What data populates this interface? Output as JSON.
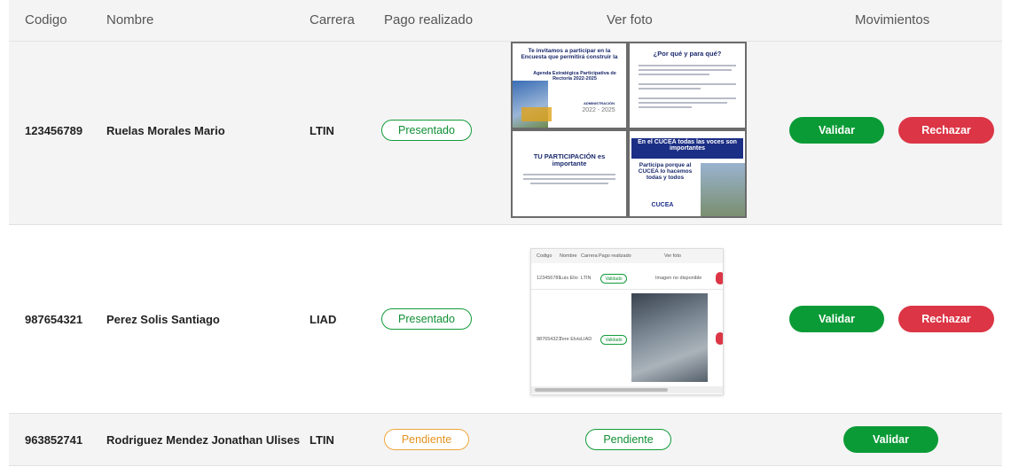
{
  "header": {
    "codigo": "Codigo",
    "nombre": "Nombre",
    "carrera": "Carrera",
    "pago": "Pago realizado",
    "foto": "Ver foto",
    "movimientos": "Movimientos"
  },
  "rows": [
    {
      "codigo": "123456789",
      "nombre": "Ruelas Morales Mario",
      "carrera": "LTIN",
      "pago": "Presentado",
      "validar": "Validar",
      "rechazar": "Rechazar",
      "poster": {
        "p1_title": "Te invitamos a participar en la Encuesta que permitirá construir la",
        "p1_sub": "Agenda Estratégica Participativa de Rectoría 2022-2025",
        "p1_admin": "ADMINISTRACIÓN",
        "p1_years": "2022 - 2025",
        "p2_title": "¿Por qué y para qué?",
        "p3_title": "TU PARTICIPACIÓN es importante",
        "p4_band": "En el CUCEA todas las voces son importantes",
        "p4_body": "Participa porque al CUCEA lo hacemos todas y todos",
        "p4_logo": "CUCEA"
      }
    },
    {
      "codigo": "987654321",
      "nombre": "Perez Solis Santiago",
      "carrera": "LIAD",
      "pago": "Presentado",
      "validar": "Validar",
      "rechazar": "Rechazar",
      "mini": {
        "h_codigo": "Codigo",
        "h_nombre": "Nombre",
        "h_carrera": "Carrera",
        "h_pago": "Pago realizado",
        "h_foto": "Ver foto",
        "r1_codigo": "123456789",
        "r1_nombre": "Luis Elio",
        "r1_carrera": "LTIN",
        "r1_pago": "Validado",
        "r1_foto": "Imagen no disponible",
        "r2_codigo": "987654321",
        "r2_nombre": "Tere Elvis",
        "r2_carrera": "LIAD",
        "r2_pago": "Validado"
      }
    },
    {
      "codigo": "963852741",
      "nombre": "Rodriguez Mendez Jonathan Ulises",
      "carrera": "LTIN",
      "pago": "Pendiente",
      "foto_status": "Pendiente",
      "validar": "Validar"
    }
  ],
  "colors": {
    "green": "#0b9b36",
    "red": "#dc3545",
    "orange": "#f0a63b",
    "navy": "#1c2f86"
  }
}
